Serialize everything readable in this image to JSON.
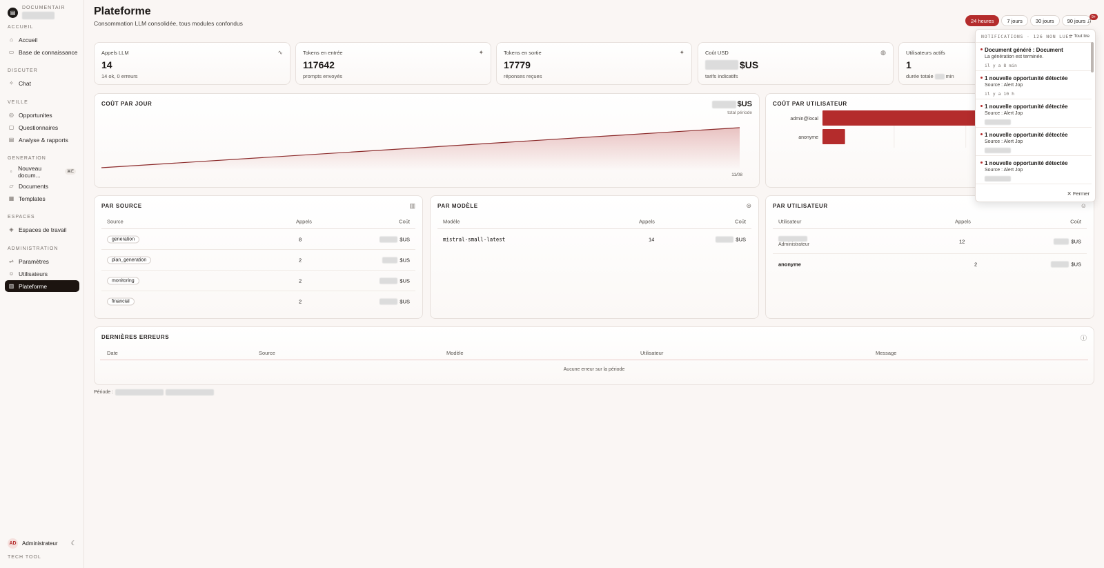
{
  "brand": {
    "name": "DOCUMENTAIR"
  },
  "nav": {
    "sections": [
      {
        "label": "ACCUEIL",
        "items": [
          {
            "label": "Accueil"
          },
          {
            "label": "Base de connaissance"
          }
        ]
      },
      {
        "label": "DISCUTER",
        "items": [
          {
            "label": "Chat"
          }
        ]
      },
      {
        "label": "VEILLE",
        "items": [
          {
            "label": "Opportunites"
          },
          {
            "label": "Questionnaires"
          },
          {
            "label": "Analyse & rapports"
          }
        ]
      },
      {
        "label": "GENERATION",
        "items": [
          {
            "label": "Nouveau docum...",
            "badge": "⌘E"
          },
          {
            "label": "Documents"
          },
          {
            "label": "Templates"
          }
        ]
      },
      {
        "label": "ESPACES",
        "items": [
          {
            "label": "Espaces de travail"
          }
        ]
      },
      {
        "label": "ADMINISTRATION",
        "items": [
          {
            "label": "Paramètres"
          },
          {
            "label": "Utilisateurs"
          },
          {
            "label": "Plateforme"
          }
        ]
      }
    ]
  },
  "user": {
    "initials": "AD",
    "name": "Administrateur"
  },
  "footer": {
    "tech": "TECH TOOL"
  },
  "header": {
    "title": "Plateforme",
    "subtitle": "Consommation LLM consolidée, tous modules confondus"
  },
  "periods": [
    "24 heures",
    "7 jours",
    "30 jours",
    "90 jours"
  ],
  "active_period": "24 heures",
  "bell_badge": "9+",
  "kpis": [
    {
      "label": "Appels LLM",
      "value": "14",
      "sub": "14 ok, 0 erreurs"
    },
    {
      "label": "Tokens en entrée",
      "value": "117642",
      "sub": "prompts envoyés"
    },
    {
      "label": "Tokens en sortie",
      "value": "17779",
      "sub": "réponses reçues"
    },
    {
      "label": "Coût USD",
      "value": "$US",
      "sub": "tarifs indicatifs"
    },
    {
      "label": "Utilisateurs actifs",
      "value": "1",
      "sub_prefix": "durée totale",
      "sub_suffix": "min"
    }
  ],
  "cost_per_day": {
    "title": "COÛT PAR JOUR",
    "unit": "$US",
    "caption": "total période",
    "date_label": "11/08"
  },
  "cost_per_user": {
    "title": "COÛT PAR UTILISATEUR"
  },
  "chart_data": [
    {
      "type": "area",
      "title": "COÛT PAR JOUR",
      "x": [
        0,
        1
      ],
      "values": [
        0,
        1
      ],
      "xlabel": "",
      "ylabel": ""
    },
    {
      "type": "bar",
      "title": "COÛT PAR UTILISATEUR",
      "categories": [
        "admin@local",
        "anonyme"
      ],
      "values": [
        12,
        1
      ]
    }
  ],
  "par_source": {
    "title": "PAR SOURCE",
    "columns": [
      "Source",
      "Appels",
      "Coût"
    ],
    "rows": [
      {
        "source": "generation",
        "calls": "8",
        "unit": "$US"
      },
      {
        "source": "plan_generation",
        "calls": "2",
        "unit": "$US"
      },
      {
        "source": "monitoring",
        "calls": "2",
        "unit": "$US"
      },
      {
        "source": "financial",
        "calls": "2",
        "unit": "$US"
      }
    ]
  },
  "par_modele": {
    "title": "PAR MODÈLE",
    "columns": [
      "Modèle",
      "Appels",
      "Coût"
    ],
    "rows": [
      {
        "model": "mistral-small-latest",
        "calls": "14",
        "unit": "$US"
      }
    ]
  },
  "par_utilisateur": {
    "title": "PAR UTILISATEUR",
    "columns": [
      "Utilisateur",
      "Appels",
      "Coût"
    ],
    "rows": [
      {
        "user": "",
        "role": "Administrateur",
        "calls": "12",
        "unit": "$US"
      },
      {
        "user": "anonyme",
        "role": "",
        "calls": "2",
        "unit": "$US"
      }
    ]
  },
  "errors": {
    "title": "DERNIÈRES ERREURS",
    "columns": [
      "Date",
      "Source",
      "Modèle",
      "Utilisateur",
      "Message"
    ],
    "empty": "Aucune erreur sur la période"
  },
  "period_label": "Période :",
  "notifications": {
    "header": "NOTIFICATIONS · 126 NON LUES",
    "read_all": "Tout lire",
    "close": "Fermer",
    "items": [
      {
        "title": "Document généré : Document",
        "desc": "La génération est terminée.",
        "time": "il y a 8 min"
      },
      {
        "title": "1 nouvelle opportunité détectée",
        "desc": "Source : Alert Jop",
        "time": "il y a 10 h"
      },
      {
        "title": "1 nouvelle opportunité détectée",
        "desc": "Source : Alert Jop",
        "time": ""
      },
      {
        "title": "1 nouvelle opportunité détectée",
        "desc": "Source : Alert Jop",
        "time": ""
      },
      {
        "title": "1 nouvelle opportunité détectée",
        "desc": "Source : Alert Jop",
        "time": ""
      }
    ]
  }
}
